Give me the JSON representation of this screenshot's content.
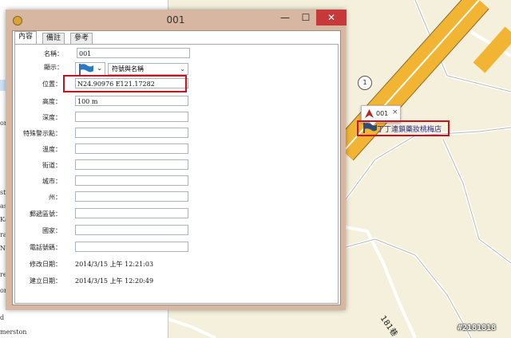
{
  "window": {
    "title": "001",
    "minimize_glyph": "—",
    "maximize_glyph": "☐",
    "close_glyph": "✕",
    "close_color": "#c7383a"
  },
  "tabs": [
    {
      "label": "內容"
    },
    {
      "label": "備註"
    },
    {
      "label": "參考"
    }
  ],
  "form": {
    "name": {
      "label": "名稱：",
      "value": "001"
    },
    "display": {
      "label": "顯示：",
      "selected": "符號與名稱",
      "symbol_icon": "blue-flag-icon"
    },
    "position": {
      "label": "位置：",
      "value": "N24.90976 E121.17282"
    },
    "altitude": {
      "label": "高度：",
      "value": "100 m"
    },
    "depth": {
      "label": "深度：",
      "value": ""
    },
    "proximity": {
      "label": "特殊警示點：",
      "value": ""
    },
    "temperature": {
      "label": "溫度：",
      "value": ""
    },
    "street": {
      "label": "街道：",
      "value": ""
    },
    "city": {
      "label": "城市：",
      "value": ""
    },
    "state": {
      "label": "州：",
      "value": ""
    },
    "postal": {
      "label": "郵遞區號：",
      "value": ""
    },
    "country": {
      "label": "國家：",
      "value": ""
    },
    "phone": {
      "label": "電話號碼：",
      "value": ""
    },
    "modified": {
      "label": "修改日期：",
      "value": "2014/3/15 上午 12:21:03"
    },
    "created": {
      "label": "建立日期：",
      "value": "2014/3/15 上午 12:20:49"
    }
  },
  "map": {
    "waypoint_popup": {
      "name": "001",
      "close_glyph": "×"
    },
    "store_label": "丁丁連鎖藥妝桃梅店",
    "route_badge": "1",
    "road_label": "181巷"
  },
  "left_panel": {
    "fragments": [
      "orth",
      "st",
      "astr",
      "Kal",
      "ram",
      "Nov",
      "re",
      "oribo",
      "d",
      "merston"
    ]
  },
  "watermark": "#2181818",
  "colors": {
    "highlight_red": "#d10e1d",
    "highway_yellow": "#f2b533",
    "map_bg": "#f4f0dc"
  }
}
